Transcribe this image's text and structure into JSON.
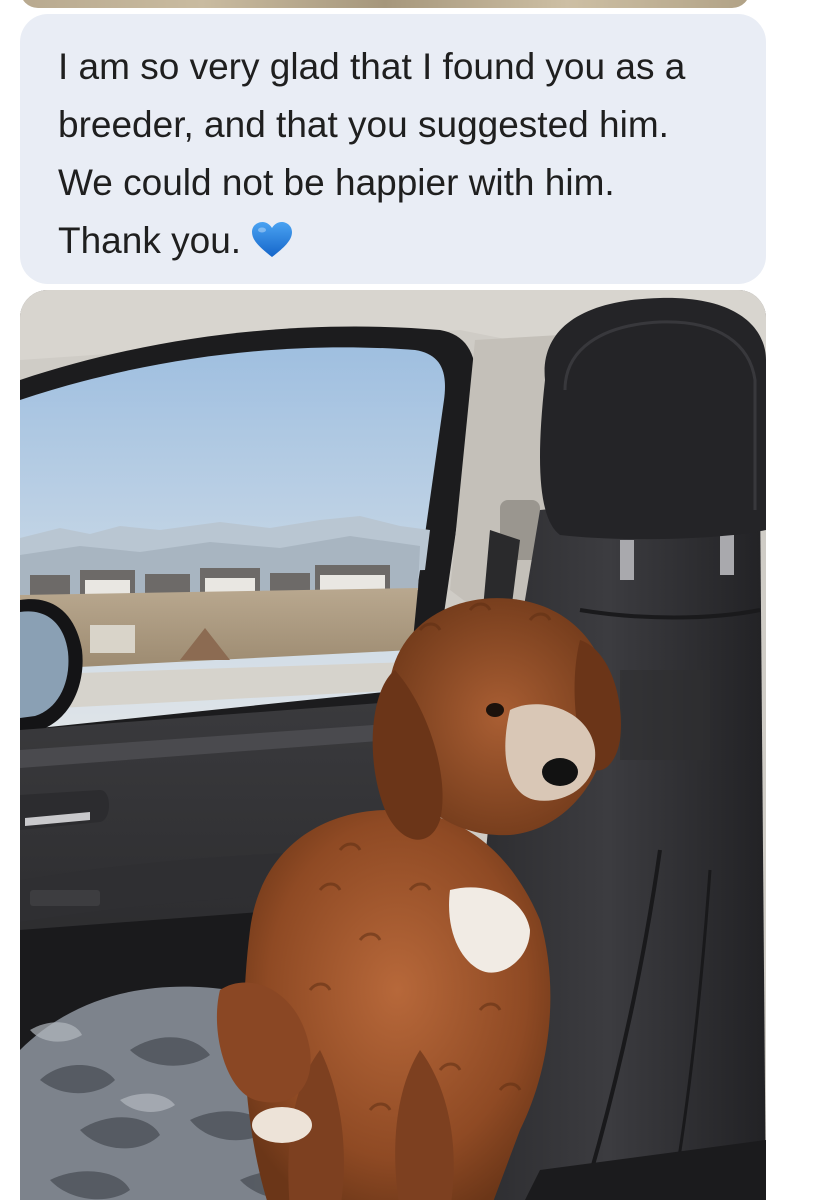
{
  "conversation": {
    "message": {
      "lines": [
        "I am so very glad that I found you as a",
        "breeder, and that you suggested him.",
        "We could not be happier with him.",
        "Thank you."
      ],
      "emoji": "blue-heart-icon",
      "bubble_color": "#e9edf5",
      "text_color": "#1f1f1f"
    },
    "attachment": {
      "type": "photo",
      "subject": "puppy"
    }
  }
}
